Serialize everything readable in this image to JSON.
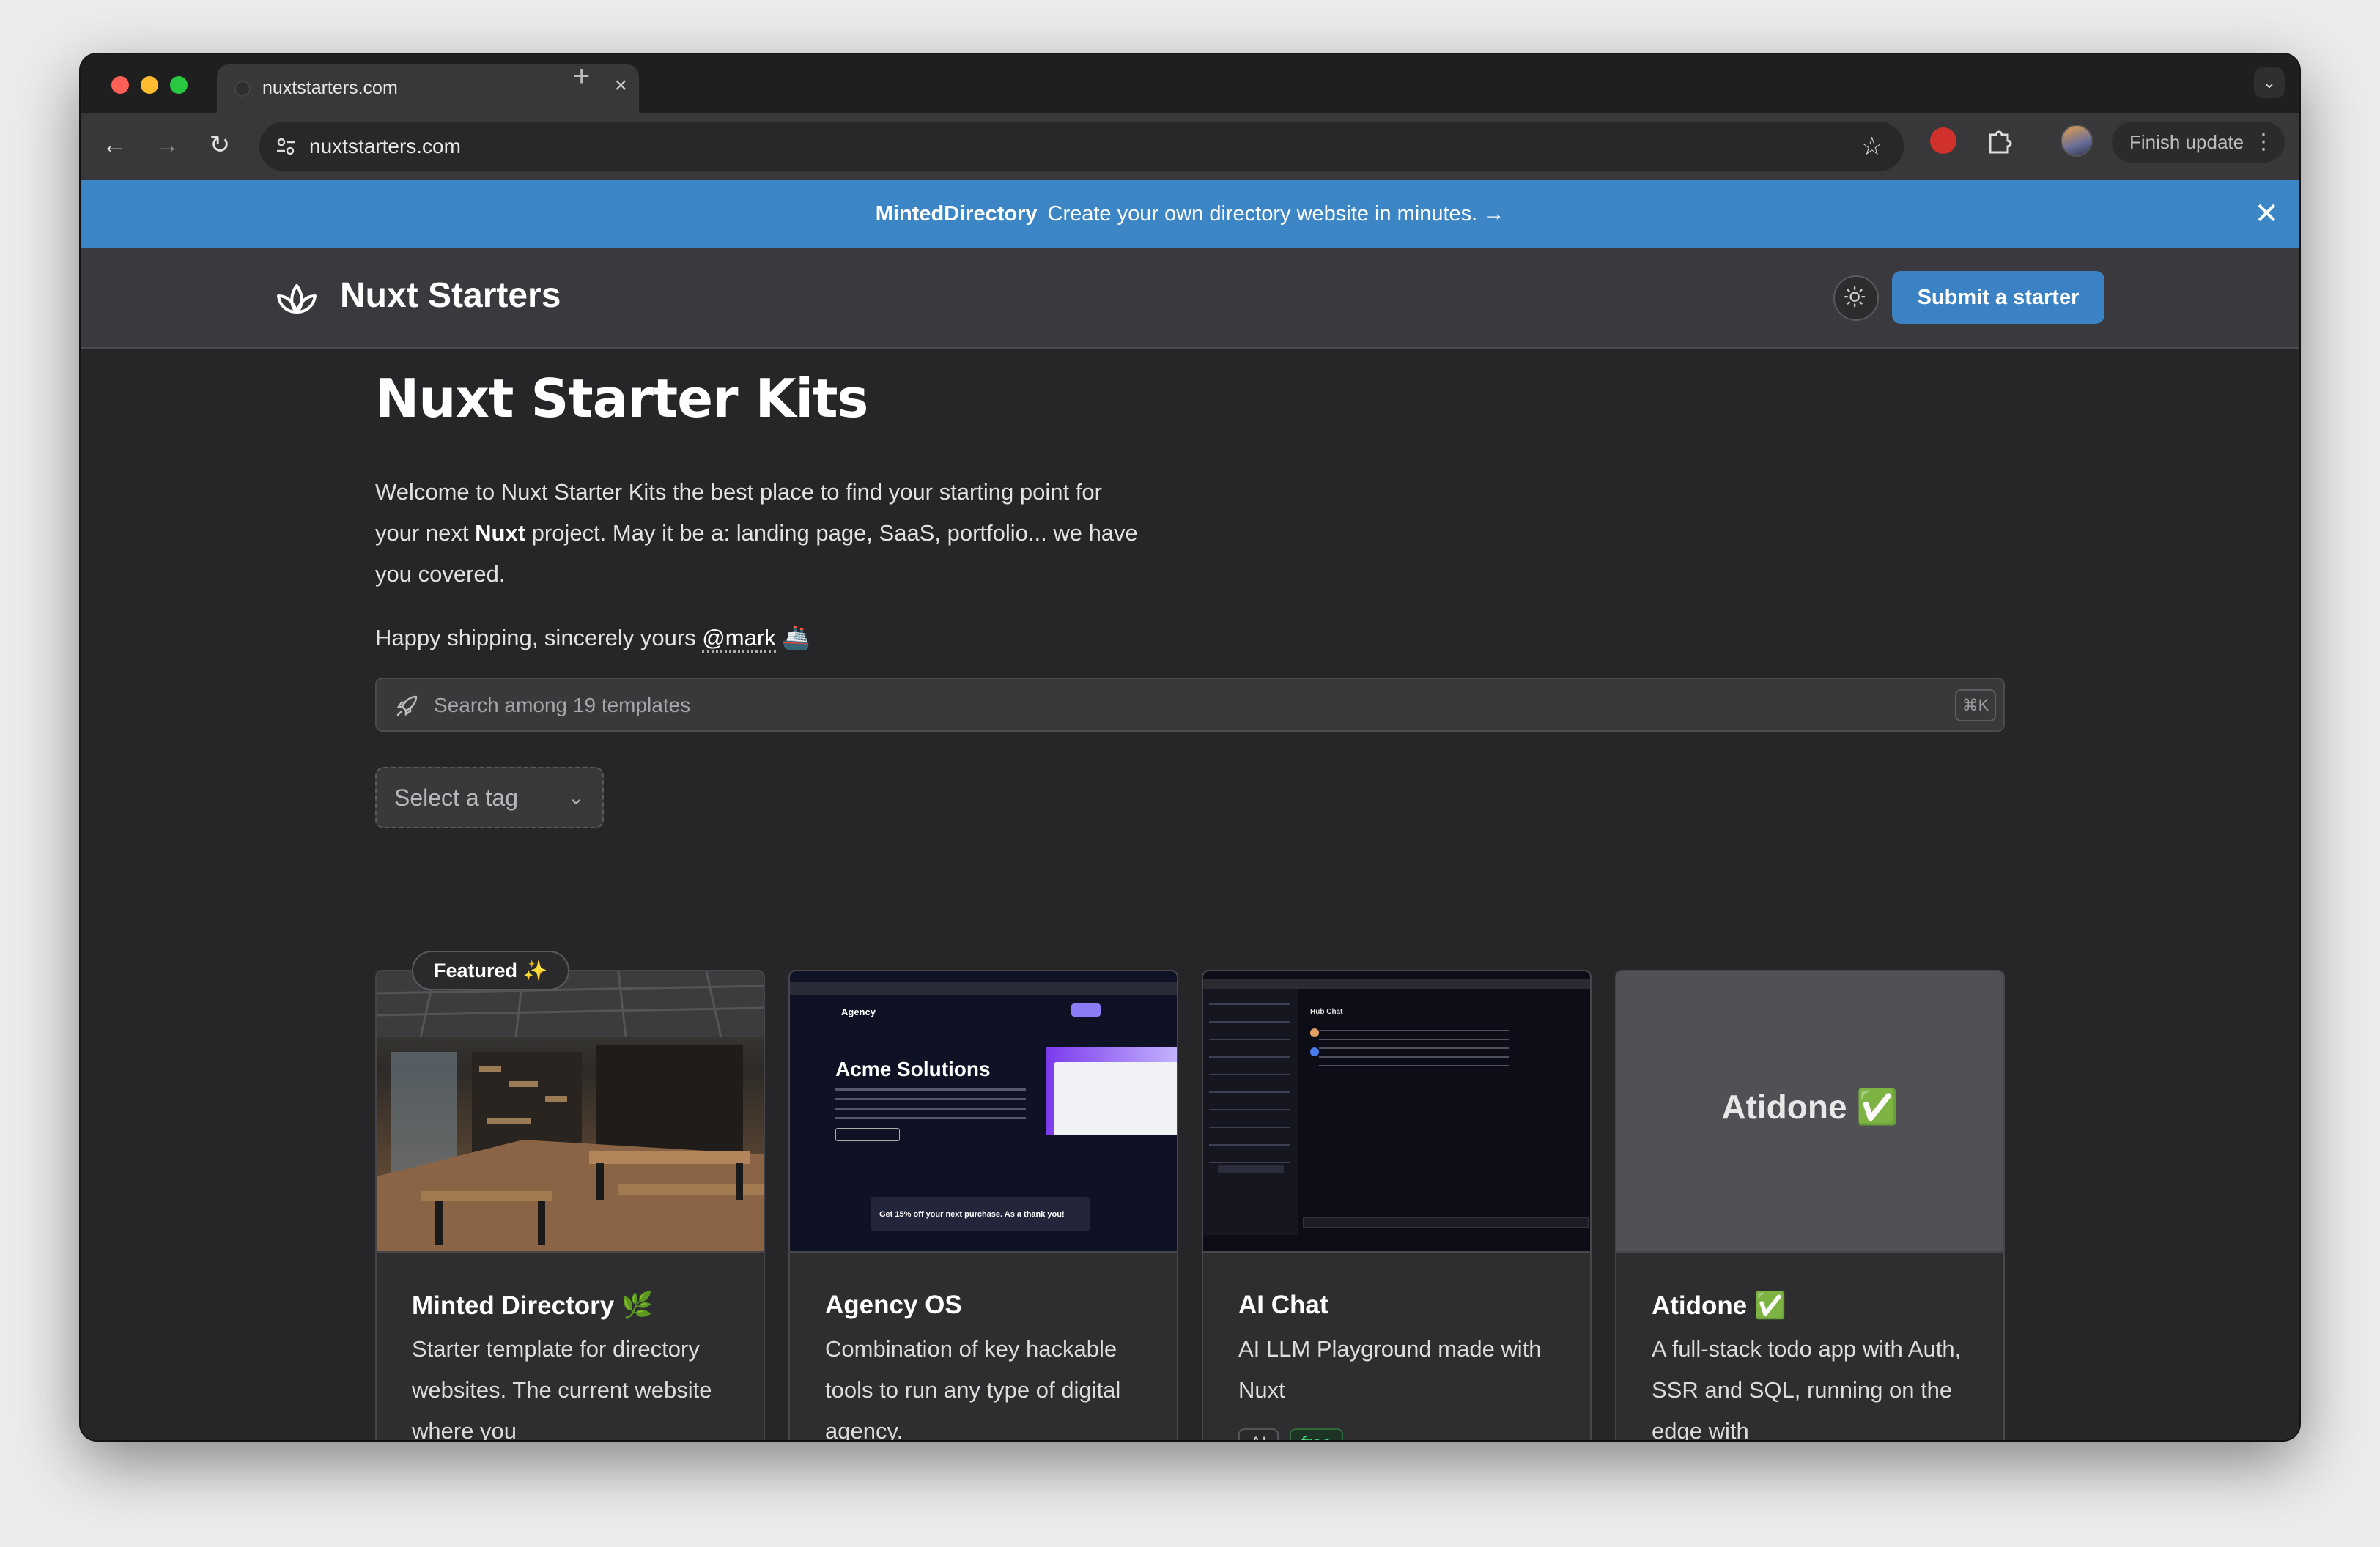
{
  "browser": {
    "tab_title": "nuxtstarters.com",
    "tab_close": "×",
    "new_tab": "+",
    "tabs_menu": "⌄",
    "back": "←",
    "forward": "→",
    "reload": "↻",
    "url": "nuxtstarters.com",
    "bookmark": "☆",
    "finish_update": "Finish update",
    "menu": "⋮"
  },
  "banner": {
    "brand": "MintedDirectory",
    "text": "Create your own directory website in minutes. →",
    "close": "✕"
  },
  "header": {
    "brand": "Nuxt Starters",
    "submit_label": "Submit a starter"
  },
  "hero": {
    "title": "Nuxt Starter Kits",
    "intro_part1": "Welcome to Nuxt Starter Kits the best place to find your starting point for your next ",
    "intro_bold": "Nuxt",
    "intro_part2": " project. May it be a: landing page, SaaS, portfolio... we have you covered.",
    "ship_text": "Happy shipping, sincerely yours ",
    "ship_link": "@mark",
    "ship_emoji": "🚢"
  },
  "search": {
    "placeholder": "Search among 19 templates",
    "shortcut": "⌘K"
  },
  "tag_filter": {
    "label": "Select a tag",
    "chevron": "⌄"
  },
  "featured_badge": "Featured ✨",
  "cards": [
    {
      "title": "Minted Directory 🌿",
      "description": "Starter template for directory websites. The current website where you"
    },
    {
      "title": "Agency OS",
      "description": "Combination of key hackable tools to run any type of digital agency.",
      "thumb_heading": "Acme Solutions",
      "thumb_brand": "Agency",
      "thumb_promo": "Get 15% off your next purchase. As a thank you!"
    },
    {
      "title": "AI Chat",
      "description": "AI LLM Playground made with Nuxt",
      "tags": [
        "AI",
        "free"
      ],
      "thumb_title": "Hub Chat"
    },
    {
      "title": "Atidone ✅",
      "description": "A full-stack todo app with Auth, SSR and SQL, running on the edge with",
      "thumb_text": "Atidone ✅"
    }
  ],
  "colors": {
    "banner": "#3d86c6",
    "accent": "#3b82c4",
    "page_bg": "#262628",
    "free_tag": "#4ade80"
  }
}
